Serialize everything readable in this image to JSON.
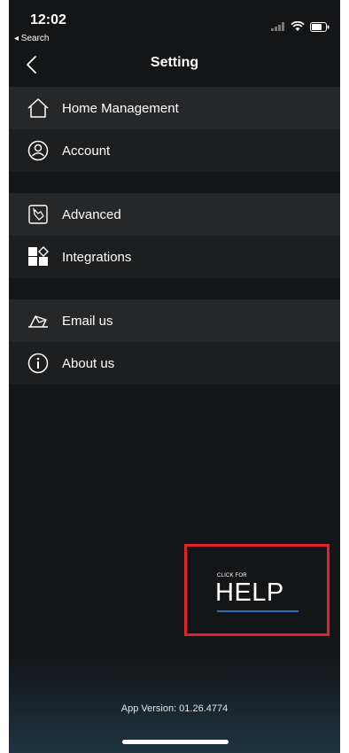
{
  "status": {
    "time": "12:02",
    "back_label": "◂ Search"
  },
  "nav": {
    "title": "Setting"
  },
  "menu": {
    "group1": [
      {
        "label": "Home Management",
        "icon": "home-icon"
      },
      {
        "label": "Account",
        "icon": "user-icon"
      }
    ],
    "group2": [
      {
        "label": "Advanced",
        "icon": "advanced-tag-icon"
      },
      {
        "label": "Integrations",
        "icon": "integrations-icon"
      }
    ],
    "group3": [
      {
        "label": "Email us",
        "icon": "email-icon"
      },
      {
        "label": "About us",
        "icon": "info-icon"
      }
    ]
  },
  "help": {
    "small_text": "CLICK FOR",
    "big_text": "HELP"
  },
  "footer": {
    "app_version": "App Version:  01.26.4774"
  },
  "colors": {
    "background": "#141517",
    "row_shade": "#262729",
    "help_border": "#e2232a",
    "help_underline": "#2b6fb8"
  }
}
